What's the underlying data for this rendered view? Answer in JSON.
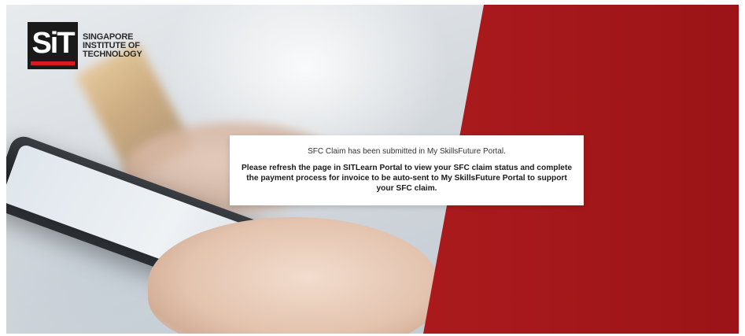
{
  "logo": {
    "mark": "SiT",
    "lines": [
      "SINGAPORE",
      "INSTITUTE OF",
      "TECHNOLOGY"
    ]
  },
  "message": {
    "line1": "SFC Claim has been submitted in My SkillsFuture Portal.",
    "line2": "Please refresh the page in SITLearn Portal to view your SFC claim status and complete the payment process for invoice to be auto-sent to My SkillsFuture Portal to support your SFC claim."
  },
  "colors": {
    "brand_red": "#b01d20",
    "logo_black": "#1a1a1a",
    "accent_red": "#d71920"
  }
}
